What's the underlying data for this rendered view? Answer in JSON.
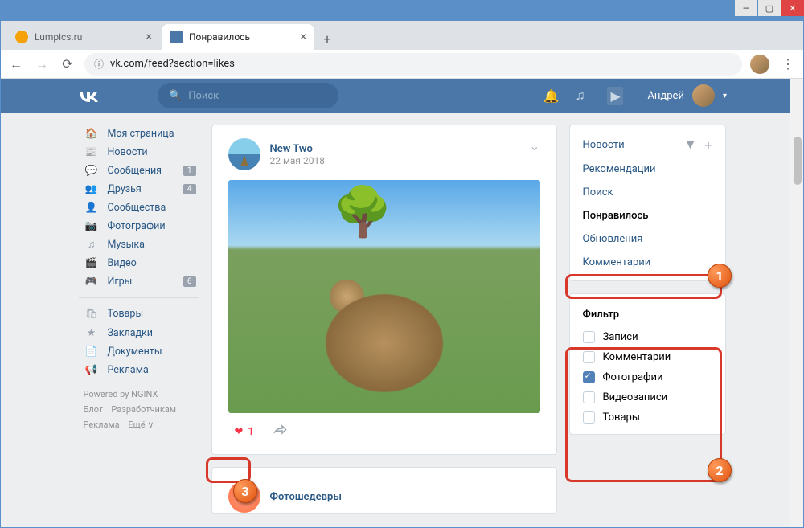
{
  "window": {
    "minimize": "—",
    "maximize": "▢",
    "close": "✕"
  },
  "browser": {
    "tabs": [
      {
        "title": "Lumpics.ru",
        "active": false,
        "favicon_color": "#f5a20a"
      },
      {
        "title": "Понравилось",
        "active": true,
        "favicon_color": "#4a76a8"
      }
    ],
    "nav": {
      "back": "←",
      "forward": "→",
      "reload": "⟳",
      "lock": "🔒",
      "url": "vk.com/feed?section=likes",
      "menu": "⋮"
    }
  },
  "vk_header": {
    "search_placeholder": "Поиск",
    "user_name": "Андрей"
  },
  "left_nav": {
    "items": [
      {
        "icon": "🏠",
        "label": "Моя страница",
        "badge": ""
      },
      {
        "icon": "📰",
        "label": "Новости",
        "badge": ""
      },
      {
        "icon": "💬",
        "label": "Сообщения",
        "badge": "1"
      },
      {
        "icon": "👥",
        "label": "Друзья",
        "badge": "4"
      },
      {
        "icon": "👤",
        "label": "Сообщества",
        "badge": ""
      },
      {
        "icon": "📷",
        "label": "Фотографии",
        "badge": ""
      },
      {
        "icon": "♫",
        "label": "Музыка",
        "badge": ""
      },
      {
        "icon": "🎬",
        "label": "Видео",
        "badge": ""
      },
      {
        "icon": "🎮",
        "label": "Игры",
        "badge": "6"
      }
    ],
    "items2": [
      {
        "icon": "🛍",
        "label": "Товары"
      },
      {
        "icon": "★",
        "label": "Закладки"
      },
      {
        "icon": "📄",
        "label": "Документы"
      },
      {
        "icon": "📢",
        "label": "Реклама"
      }
    ],
    "powered": "Powered by NGINX",
    "footer1a": "Блог",
    "footer1b": "Разработчикам",
    "footer2a": "Реклама",
    "footer2b": "Ещё ∨"
  },
  "post": {
    "author": "New Two",
    "date": "22 мая 2018",
    "like_count": "1"
  },
  "post2": {
    "author": "Фотошедевры"
  },
  "side": {
    "tabs": [
      "Новости",
      "Рекомендации",
      "Поиск",
      "Понравилось",
      "Обновления",
      "Комментарии"
    ],
    "active_tab": "Понравилось",
    "filter_title": "Фильтр",
    "filters": [
      {
        "label": "Записи",
        "checked": false
      },
      {
        "label": "Комментарии",
        "checked": false
      },
      {
        "label": "Фотографии",
        "checked": true
      },
      {
        "label": "Видеозаписи",
        "checked": false
      },
      {
        "label": "Товары",
        "checked": false
      }
    ]
  },
  "anno": {
    "n1": "1",
    "n2": "2",
    "n3": "3"
  }
}
